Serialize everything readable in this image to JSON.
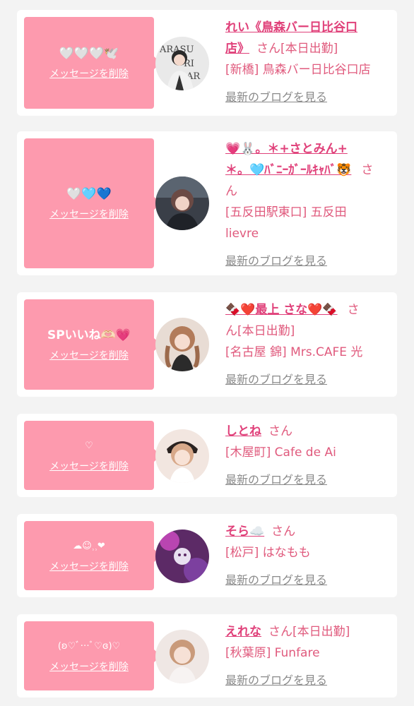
{
  "delete_label": "メッセージを削除",
  "blog_label": "最新のブログを見る",
  "san": "さん",
  "cards": [
    {
      "message": "🤍🤍🤍🕊️",
      "name_lines": [
        "れい《鳥森バー日比谷口",
        "店》"
      ],
      "suffix": "[本日出勤]",
      "shop_lines": [
        "[新橋] 鳥森バー日比谷口店"
      ]
    },
    {
      "message": "🤍🩵💙",
      "name_lines": [
        "💗🐰。＊+さとみん+",
        "＊。🩵ﾊﾞﾆｰｶﾞｰﾙｷｬﾊﾞ🐯"
      ],
      "suffix": "",
      "san_wrap": "ん",
      "shop_lines": [
        "[五反田駅東口] 五反田",
        "lievre"
      ]
    },
    {
      "message": "SPいいね🫶🏻💗",
      "name_lines": [
        "🍫❤️最上 さな❤️🍫"
      ],
      "suffix": "",
      "san_wrap": "ん[本日出勤]",
      "shop_lines": [
        "[名古屋 錦] Mrs.CAFE 光"
      ]
    },
    {
      "message": "♡",
      "name_lines": [
        "しとね"
      ],
      "suffix": "",
      "shop_lines": [
        "[木屋町] Cafe de Ai"
      ]
    },
    {
      "message": "︎︎☁︎☺︎⸒⸒❤︎",
      "name_lines": [
        "そら☁️"
      ],
      "suffix": "",
      "shop_lines": [
        "[松戸] はなもも"
      ]
    },
    {
      "message": "(ʚ♡ﾞ⋯ﾞ♡ɞ)♡",
      "name_lines": [
        "えれな"
      ],
      "suffix": "[本日出勤]",
      "shop_lines": [
        "[秋葉原] Funfare"
      ]
    }
  ]
}
